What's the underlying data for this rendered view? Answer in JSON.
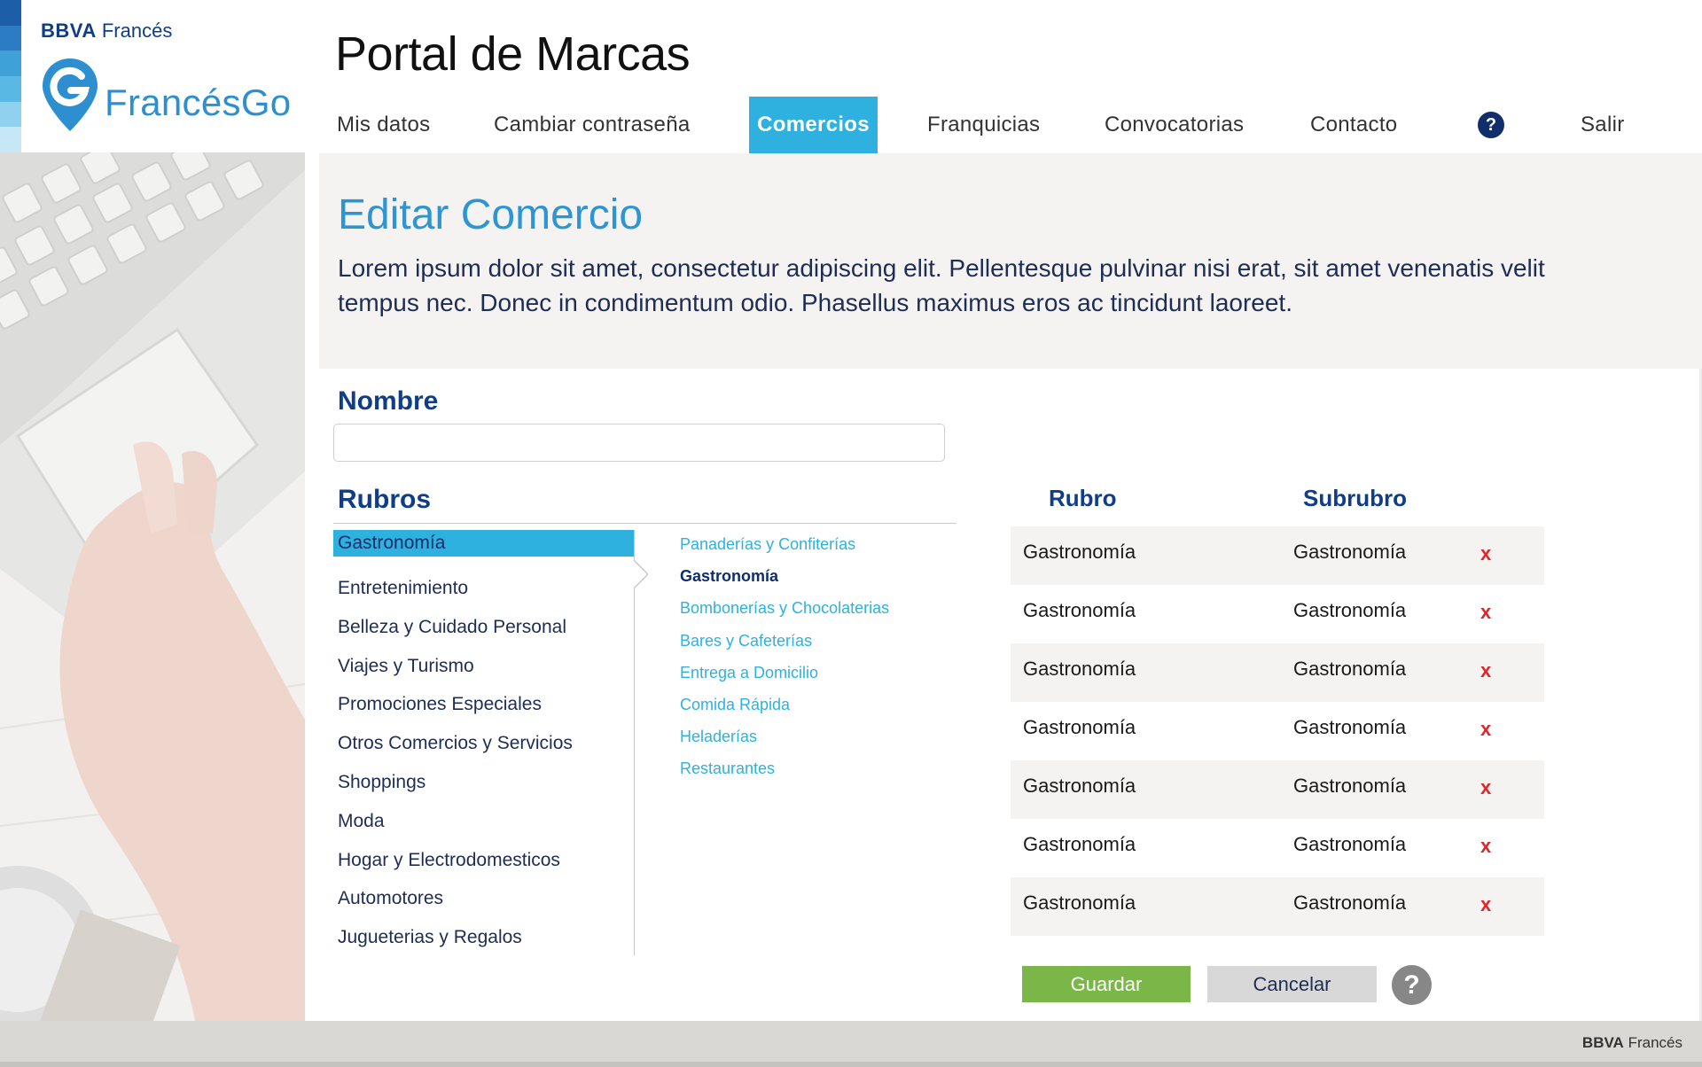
{
  "brand": {
    "bank_bold": "BBVA",
    "bank_light": "Francés",
    "product": "FrancésGo",
    "stripe_colors": [
      "#1d5ea8",
      "#2b7cc3",
      "#3ea1d8",
      "#5ab8e4",
      "#8fd1ee",
      "#c5e7f6"
    ]
  },
  "header": {
    "title": "Portal de Marcas",
    "nav": [
      {
        "label": "Mis datos"
      },
      {
        "label": "Cambiar contraseña"
      },
      {
        "label": "Comercios",
        "active": true
      },
      {
        "label": "Franquicias"
      },
      {
        "label": "Convocatorias"
      },
      {
        "label": "Contacto"
      },
      {
        "label": "?"
      },
      {
        "label": "Salir"
      }
    ]
  },
  "intro": {
    "title": "Editar Comercio",
    "text": "Lorem ipsum dolor sit amet, consectetur adipiscing elit. Pellentesque pulvinar nisi erat, sit amet venenatis velit tempus nec. Donec in condimentum odio. Phasellus maximus eros ac tincidunt laoreet."
  },
  "form": {
    "nombre_label": "Nombre",
    "nombre_value": "",
    "nombre_placeholder": "",
    "rubros_label": "Rubros",
    "categories": [
      {
        "label": "Gastronomía",
        "active": true
      },
      {
        "label": "Entretenimiento"
      },
      {
        "label": "Belleza y Cuidado Personal"
      },
      {
        "label": "Viajes y Turismo"
      },
      {
        "label": "Promociones Especiales"
      },
      {
        "label": "Otros Comercios y Servicios"
      },
      {
        "label": "Shoppings"
      },
      {
        "label": "Moda"
      },
      {
        "label": "Hogar y Electrodomesticos"
      },
      {
        "label": "Automotores"
      },
      {
        "label": "Jugueterias y Regalos"
      }
    ],
    "subcategories": [
      {
        "label": "Panaderías y Confiterías"
      },
      {
        "label": "Gastronomía",
        "selected": true
      },
      {
        "label": "Bombonerías y Chocolaterias"
      },
      {
        "label": "Bares y Cafeterías"
      },
      {
        "label": "Entrega a Domicilio"
      },
      {
        "label": "Comida Rápida"
      },
      {
        "label": "Heladerías"
      },
      {
        "label": "Restaurantes"
      }
    ]
  },
  "table": {
    "headers": {
      "rubro": "Rubro",
      "subrubro": "Subrubro"
    },
    "delete_symbol": "x",
    "rows": [
      {
        "rubro": "Gastronomía",
        "subrubro": "Gastronomía"
      },
      {
        "rubro": "Gastronomía",
        "subrubro": "Gastronomía"
      },
      {
        "rubro": "Gastronomía",
        "subrubro": "Gastronomía"
      },
      {
        "rubro": "Gastronomía",
        "subrubro": "Gastronomía"
      },
      {
        "rubro": "Gastronomía",
        "subrubro": "Gastronomía"
      },
      {
        "rubro": "Gastronomía",
        "subrubro": "Gastronomía"
      },
      {
        "rubro": "Gastronomía",
        "subrubro": "Gastronomía"
      }
    ]
  },
  "actions": {
    "save": "Guardar",
    "cancel": "Cancelar",
    "help": "?"
  },
  "footer": {
    "brand_bold": "BBVA",
    "brand_light": "Francés"
  },
  "colors": {
    "accent": "#2eb1de",
    "brand_dark": "#0f3d87",
    "save": "#7ab648",
    "delete": "#e0262b"
  },
  "icons": {
    "logo": "location-pin-g-icon",
    "help": "question-circle-icon",
    "delete": "close-icon",
    "arrow": "chevron-right-icon"
  }
}
